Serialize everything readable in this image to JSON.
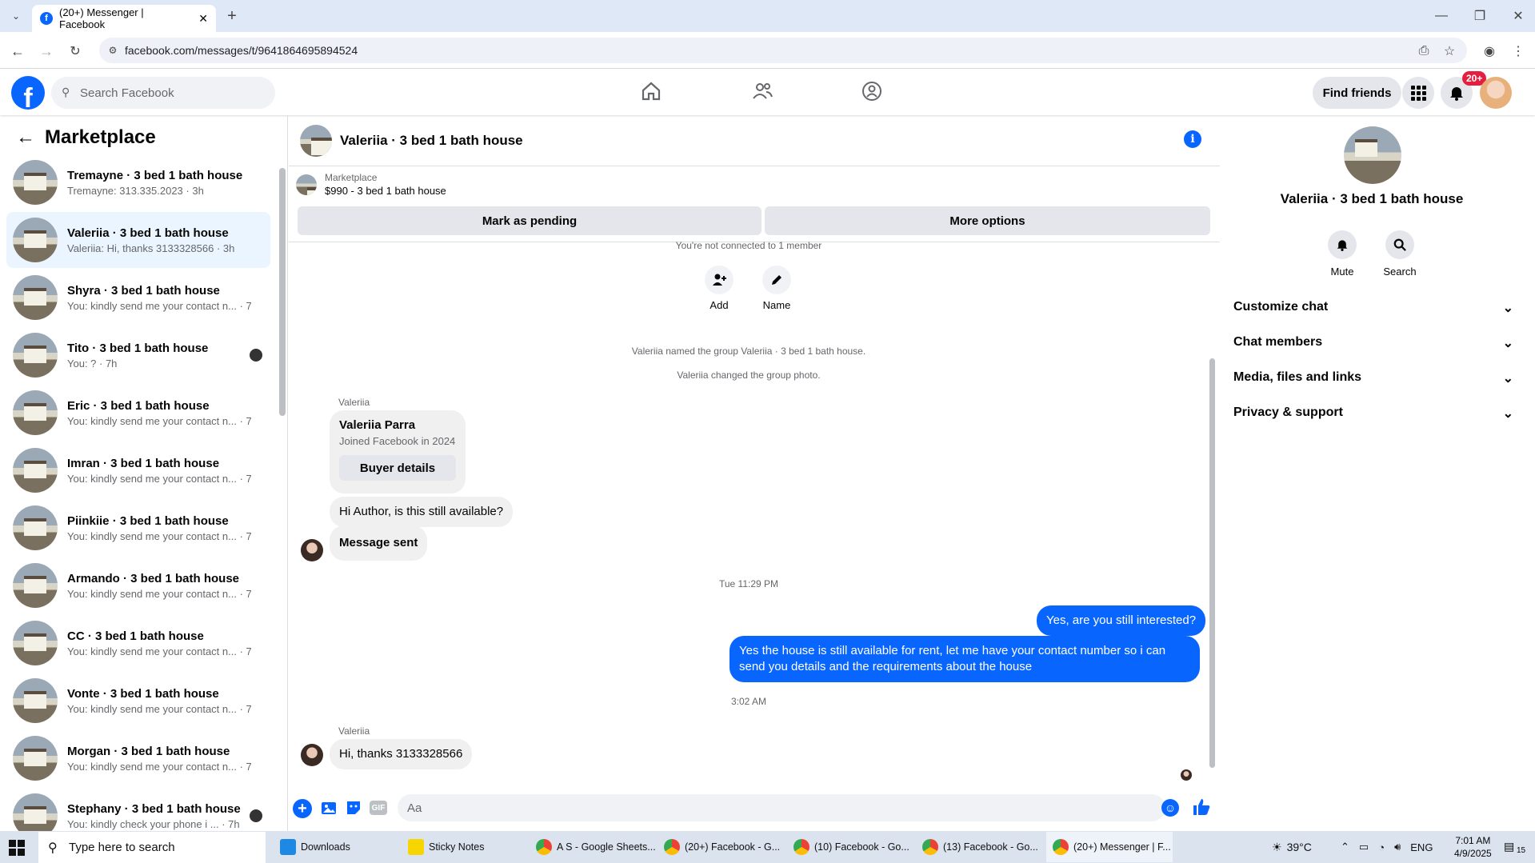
{
  "browser": {
    "tab_title": "(20+) Messenger | Facebook",
    "url": "facebook.com/messages/t/9641864695894524"
  },
  "header": {
    "search_placeholder": "Search Facebook",
    "find_friends": "Find friends",
    "notif_badge": "20+"
  },
  "left": {
    "title": "Marketplace",
    "conversations": [
      {
        "name": "Tremayne · 3 bed 1 bath house",
        "snippet": "Tremayne: 313.335.2023 · 3h"
      },
      {
        "name": "Valeriia · 3 bed 1 bath house",
        "snippet": "Valeriia: Hi, thanks 3133328566 · 3h"
      },
      {
        "name": "Shyra · 3 bed 1 bath house",
        "snippet": "You: kindly send me your contact n... · 7h"
      },
      {
        "name": "Tito · 3 bed 1 bath house",
        "snippet": "You: ? · 7h"
      },
      {
        "name": "Eric · 3 bed 1 bath house",
        "snippet": "You: kindly send me your contact n... · 7h"
      },
      {
        "name": "Imran · 3 bed 1 bath house",
        "snippet": "You: kindly send me your contact n... · 7h"
      },
      {
        "name": "Piinkiie · 3 bed 1 bath house",
        "snippet": "You: kindly send me your contact n... · 7h"
      },
      {
        "name": "Armando · 3 bed 1 bath house",
        "snippet": "You: kindly send me your contact n... · 7h"
      },
      {
        "name": "CC · 3 bed 1 bath house",
        "snippet": "You: kindly send me your contact n... · 7h"
      },
      {
        "name": "Vonte · 3 bed 1 bath house",
        "snippet": "You: kindly send me your contact n... · 7h"
      },
      {
        "name": "Morgan · 3 bed 1 bath house",
        "snippet": "You: kindly send me your contact n... · 7h"
      },
      {
        "name": "Stephany · 3 bed 1 bath house",
        "snippet": "You: kindly check your phone i ... · 7h"
      }
    ]
  },
  "chat": {
    "title": "Valeriia · 3 bed 1 bath house",
    "marketplace_label": "Marketplace",
    "listing": "$990 - 3 bed 1 bath house",
    "mark_pending": "Mark as pending",
    "more_options": "More options",
    "not_connected": "You're not connected to 1 member",
    "add": "Add",
    "name": "Name",
    "sys1": "Valeriia named the group Valeriia · 3 bed 1 bath house.",
    "sys2": "Valeriia changed the group photo.",
    "sender": "Valeriia",
    "card_name": "Valeriia Parra",
    "card_joined": "Joined Facebook in 2024",
    "buyer_details": "Buyer details",
    "msg1": "Hi Author, is this still available?",
    "msg2": "Message sent",
    "time1": "Tue 11:29 PM",
    "out1": "Yes, are you still interested?",
    "out2": "Yes the house is still available for rent, let me have your contact number so i can send you details and the requirements about the house",
    "time2": "3:02 AM",
    "msg3": "Hi, thanks 3133328566",
    "composer_placeholder": "Aa"
  },
  "right": {
    "title": "Valeriia · 3 bed 1 bath house",
    "mute": "Mute",
    "search": "Search",
    "sections": [
      "Customize chat",
      "Chat members",
      "Media, files and links",
      "Privacy & support"
    ]
  },
  "taskbar": {
    "search": "Type here to search",
    "apps": [
      "Downloads",
      "Sticky Notes",
      "A S - Google Sheets...",
      "(20+) Facebook - G...",
      "(10) Facebook - Go...",
      "(13) Facebook - Go...",
      "(20+) Messenger | F..."
    ],
    "temp": "39°C",
    "lang": "ENG",
    "time": "7:01 AM",
    "date": "4/9/2025",
    "notif_count": "15"
  },
  "colors": {
    "brand": "#0866ff",
    "active_row": "#ebf5ff"
  }
}
